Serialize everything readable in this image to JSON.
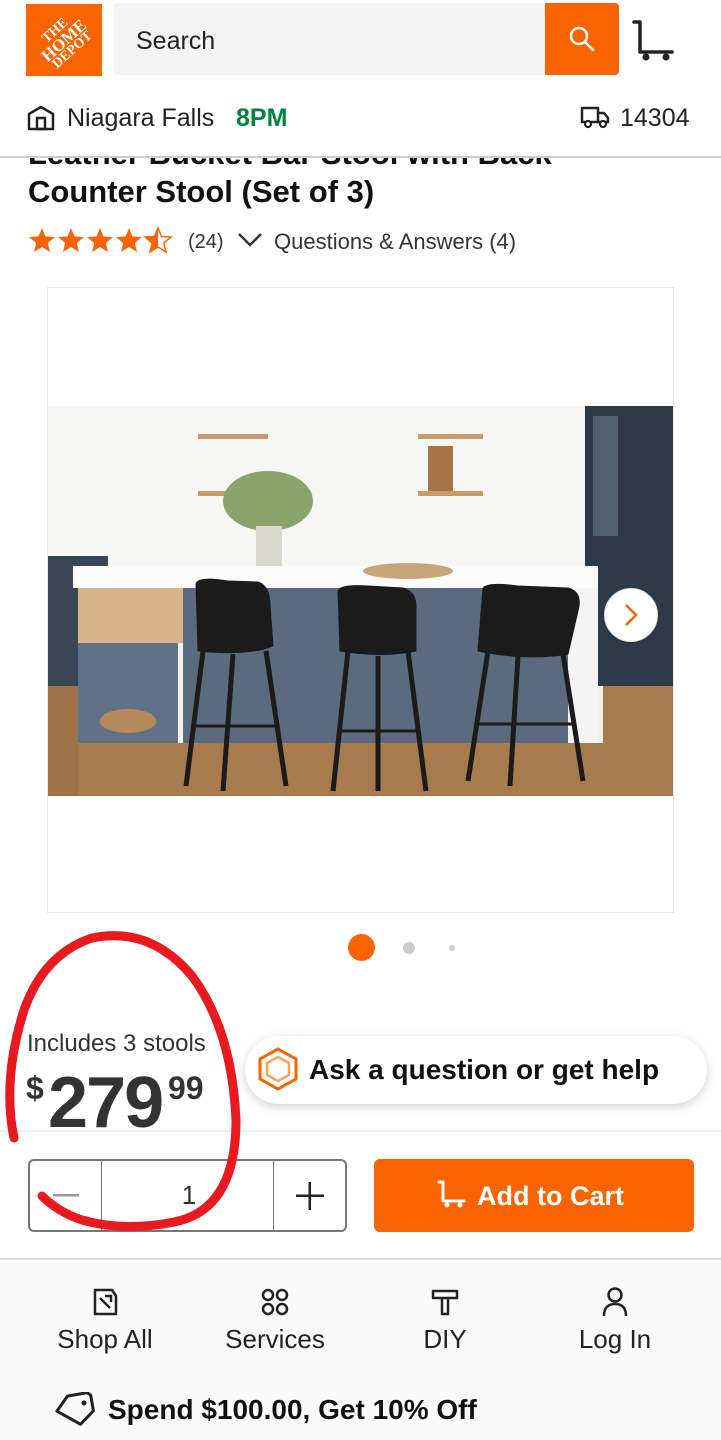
{
  "header": {
    "logo_lines": [
      "THE",
      "HOME",
      "DEPOT"
    ],
    "search_placeholder": "Search",
    "accent_color": "#f96302"
  },
  "store": {
    "name": "Niagara Falls",
    "hours": "8PM",
    "zip": "14304"
  },
  "product": {
    "title_partial_line": "Leather Bucket Bar Stool with Back",
    "title": "Counter Stool (Set of 3)",
    "rating": 4.5,
    "review_count": "(24)",
    "qa_label": "Questions & Answers (4)"
  },
  "gallery": {
    "image_count": 3,
    "active_index": 0
  },
  "pricing": {
    "includes": "Includes 3 stools",
    "dollar_sign": "$",
    "whole": "279",
    "cents": "99"
  },
  "help": {
    "label": "Ask a question or get help"
  },
  "cart": {
    "quantity": "1",
    "add_label": "Add to Cart"
  },
  "bottom_nav": {
    "items": [
      {
        "label": "Shop All",
        "icon": "shop-all-icon"
      },
      {
        "label": "Services",
        "icon": "services-icon"
      },
      {
        "label": "DIY",
        "icon": "diy-icon"
      },
      {
        "label": "Log In",
        "icon": "user-icon"
      }
    ]
  },
  "promo": {
    "text": "Spend $100.00, Get 10% Off"
  }
}
